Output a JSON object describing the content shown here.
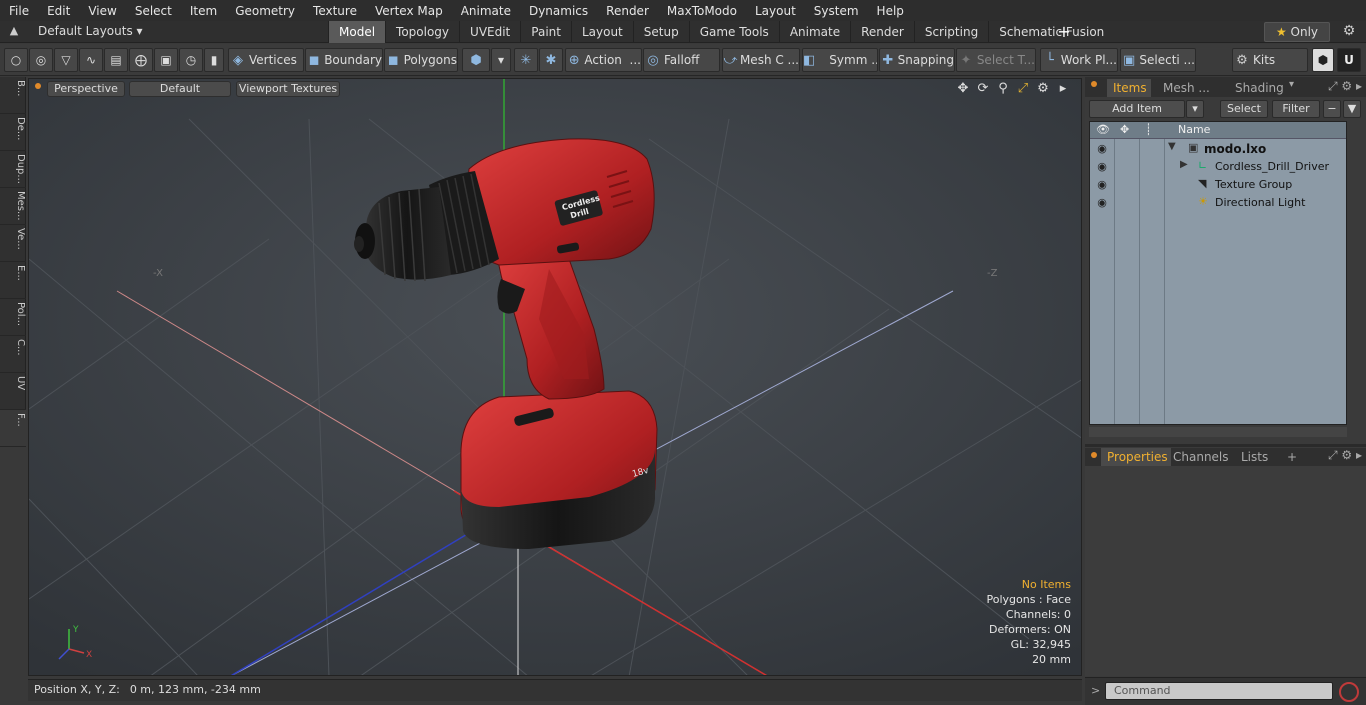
{
  "menu": [
    "File",
    "Edit",
    "View",
    "Select",
    "Item",
    "Geometry",
    "Texture",
    "Vertex Map",
    "Animate",
    "Dynamics",
    "Render",
    "MaxToModo",
    "Layout",
    "System",
    "Help"
  ],
  "layout_selector": "Default Layouts ▾",
  "tabs": [
    {
      "label": "Model",
      "active": true
    },
    {
      "label": "Topology",
      "active": false
    },
    {
      "label": "UVEdit",
      "active": false
    },
    {
      "label": "Paint",
      "active": false
    },
    {
      "label": "Layout",
      "active": false
    },
    {
      "label": "Setup",
      "active": false
    },
    {
      "label": "Game Tools",
      "active": false
    },
    {
      "label": "Animate",
      "active": false
    },
    {
      "label": "Render",
      "active": false
    },
    {
      "label": "Scripting",
      "active": false
    },
    {
      "label": "Schematic Fusion",
      "active": false
    }
  ],
  "tab_add": "+",
  "only_button": "Only",
  "toolbar": {
    "vertices": "Vertices",
    "boundary": "Boundary",
    "polygons": "Polygons",
    "action": "Action",
    "falloff": "Falloff",
    "mesh_c": "Mesh C ...",
    "symm": "Symm ...",
    "snapping": "Snapping",
    "select_t": "Select T...",
    "work_pl": "Work Pl...",
    "selecti": "Selecti ...",
    "kits": "Kits"
  },
  "left_strip": [
    "B...",
    "De...",
    "Dup...",
    "Mes...",
    "Ve...",
    "E...",
    "Pol...",
    "C...",
    "UV",
    "F..."
  ],
  "viewport": {
    "perspective": "Perspective",
    "default": "Default",
    "textures": "Viewport Textures",
    "axis_neg_x": "-X",
    "axis_neg_z": "-Z",
    "gizmo_x": "X",
    "gizmo_y": "Y",
    "info": {
      "no_items": "No Items",
      "polygons": "Polygons : Face",
      "channels": "Channels: 0",
      "deformers": "Deformers: ON",
      "gl": "GL: 32,945",
      "scale": "20 mm"
    },
    "decal_line1": "Cordless",
    "decal_line2": "Drill",
    "battery_label": "18v"
  },
  "status": {
    "label": "Position X, Y, Z:",
    "value": "0 m, 123 mm, -234 mm"
  },
  "items_panel": {
    "tabs": [
      "Items",
      "Mesh ...",
      "Shading"
    ],
    "add_item": "Add Item",
    "select": "Select",
    "filter": "Filter",
    "column_name": "Name",
    "rows": [
      {
        "name": "modo.lxo"
      },
      {
        "name": "Cordless_Drill_Driver"
      },
      {
        "name": "Texture Group"
      },
      {
        "name": "Directional Light"
      }
    ]
  },
  "props_panel": {
    "tabs": [
      "Properties",
      "Channels",
      "Lists"
    ],
    "add": "+"
  },
  "command": {
    "placeholder": "Command"
  },
  "colors": {
    "drill_red": "#c8282a",
    "drill_black": "#1a1a1a",
    "accent_orange": "#f0b030",
    "axis_x": "#d04040",
    "axis_y": "#40c040",
    "axis_z": "#4050d0"
  }
}
